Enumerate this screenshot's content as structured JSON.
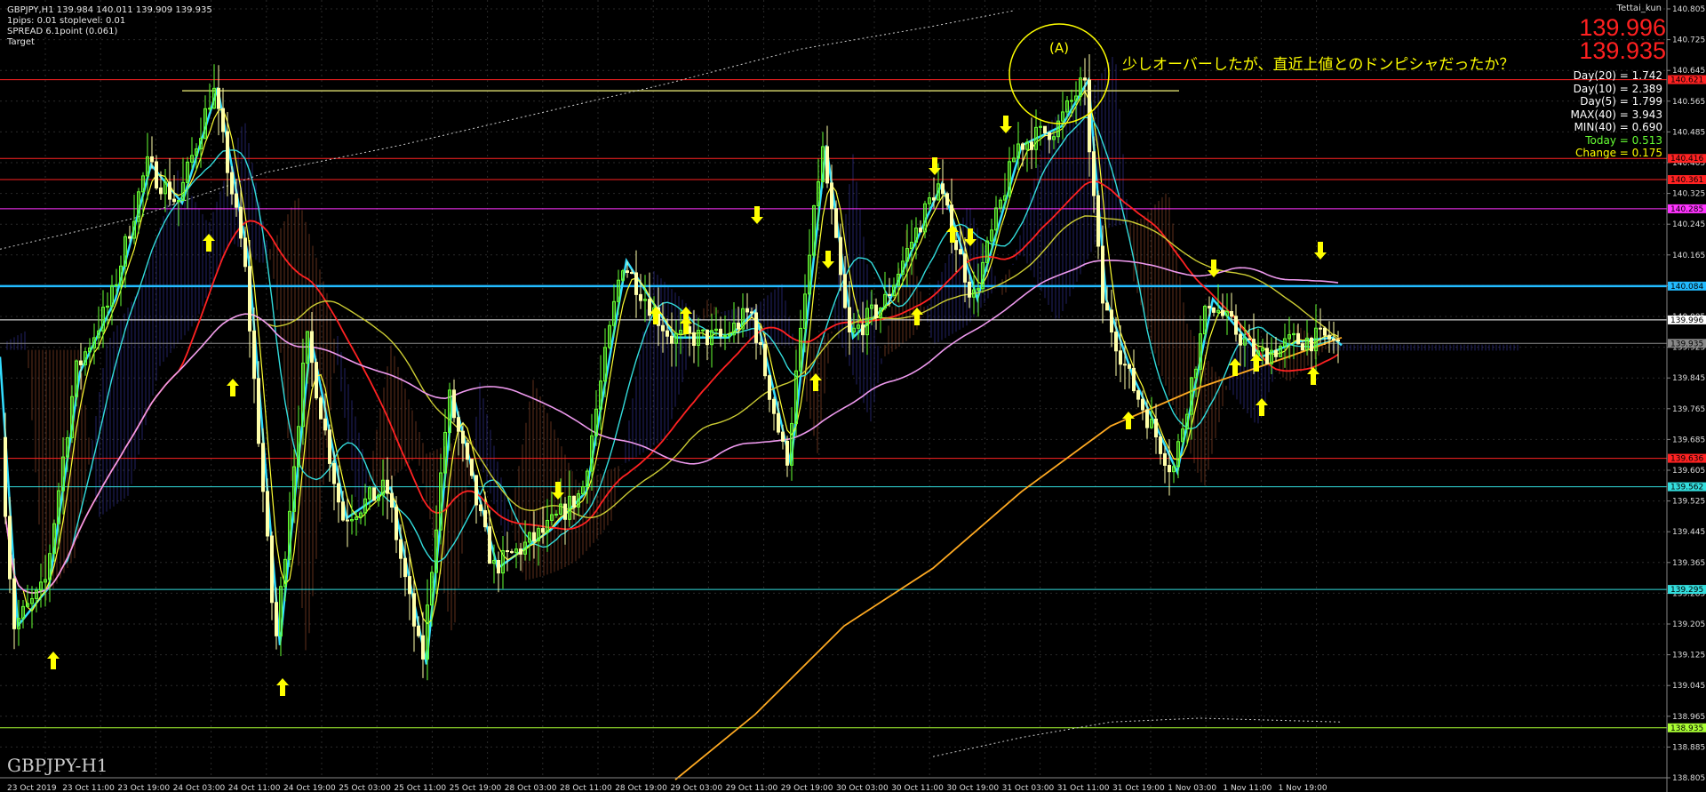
{
  "chart_data": {
    "type": "candlestick",
    "symbol_label": "GBPJPY-H1",
    "header_lines": [
      "GBPJPY,H1 139.984 140.011 139.909 139.935",
      "1pips: 0.01  stoplevel: 0.01",
      "SPREAD 6.1point (0.061)",
      "Target"
    ],
    "user_label": "Tettai_kun",
    "bid_price": "139.996",
    "ask_price": "139.935",
    "stats": [
      {
        "text": "Day(20) = 1.742",
        "color": "#ffffff"
      },
      {
        "text": "Day(10) = 2.389",
        "color": "#ffffff"
      },
      {
        "text": "Day(5) = 1.799",
        "color": "#ffffff"
      },
      {
        "text": "MAX(40) = 3.943",
        "color": "#ffffff"
      },
      {
        "text": "MIN(40) = 0.690",
        "color": "#ffffff"
      },
      {
        "text": "Today = 0.513",
        "color": "#66ff33"
      },
      {
        "text": "Change = 0.175",
        "color": "#ffff00"
      }
    ],
    "annotation": "少しオーバーしたが、直近上値とのドンピシャだったか？",
    "circle_label": "(A)",
    "ylim": [
      138.805,
      140.805
    ],
    "y_ticks": [
      "140.805",
      "140.725",
      "140.645",
      "140.565",
      "140.485",
      "140.405",
      "140.325",
      "140.245",
      "140.165",
      "140.085",
      "140.005",
      "139.925",
      "139.845",
      "139.765",
      "139.685",
      "139.605",
      "139.525",
      "139.445",
      "139.365",
      "139.285",
      "139.205",
      "139.125",
      "139.045",
      "138.965",
      "138.885",
      "138.805"
    ],
    "x_labels": [
      "23 Oct 2019",
      "23 Oct 11:00",
      "23 Oct 19:00",
      "24 Oct 03:00",
      "24 Oct 11:00",
      "24 Oct 19:00",
      "25 Oct 03:00",
      "25 Oct 11:00",
      "25 Oct 19:00",
      "28 Oct 03:00",
      "28 Oct 11:00",
      "28 Oct 19:00",
      "29 Oct 03:00",
      "29 Oct 11:00",
      "29 Oct 19:00",
      "30 Oct 03:00",
      "30 Oct 11:00",
      "30 Oct 19:00",
      "31 Oct 03:00",
      "31 Oct 11:00",
      "31 Oct 19:00",
      "1 Nov 03:00",
      "1 Nov 11:00",
      "1 Nov 19:00"
    ],
    "hlines": [
      {
        "price": 140.621,
        "label": "140.621",
        "color": "#ff2222"
      },
      {
        "price": 140.416,
        "label": "140.416",
        "color": "#ff2222"
      },
      {
        "price": 140.361,
        "label": "140.361",
        "color": "#ff2222"
      },
      {
        "price": 140.285,
        "label": "140.285",
        "color": "#ff33ff"
      },
      {
        "price": 140.084,
        "label": "140.084",
        "color": "#22bbff"
      },
      {
        "price": 139.996,
        "label": "139.996",
        "color": "#ffffff"
      },
      {
        "price": 139.935,
        "label": "139.935",
        "color": "#888888"
      },
      {
        "price": 139.636,
        "label": "139.636",
        "color": "#ff2222"
      },
      {
        "price": 139.562,
        "label": "139.562",
        "color": "#33dddd"
      },
      {
        "price": 139.295,
        "label": "139.295",
        "color": "#33dddd"
      },
      {
        "price": 138.935,
        "label": "138.935",
        "color": "#aaff33"
      }
    ],
    "colors": {
      "up": "#66ff33",
      "down": "#ffffaa",
      "grid": "#2a2a2a",
      "zigzag": "#33ddff",
      "arrow": "#ffff00"
    }
  }
}
